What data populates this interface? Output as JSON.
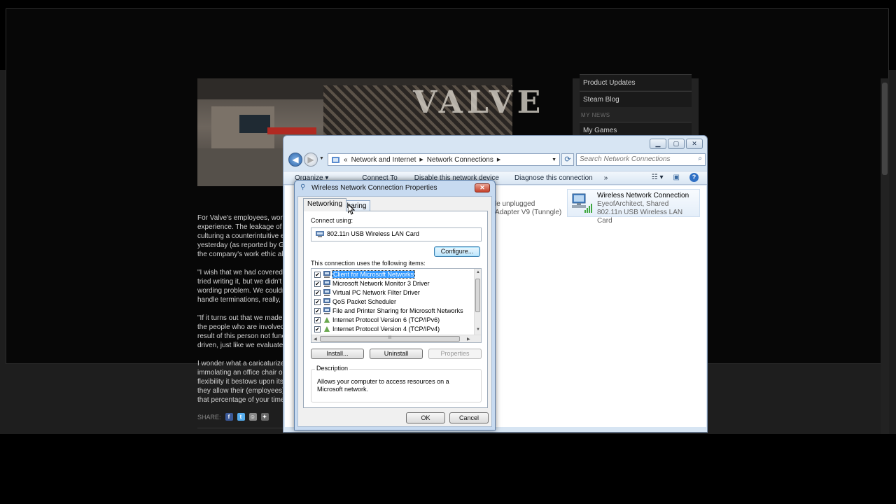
{
  "browser": {
    "logo_text": "VALVE",
    "article": {
      "paragraphs": [
        [
          "For Valve's employees, worki",
          "experience. The leakage of Va",
          "culturing a counterintuitive en",
          "yesterday (as reported by Gee",
          "the company's work ethic also"
        ],
        [
          "\"I wish that we had covered fir",
          "tried writing it, but we didn't fe",
          "wording problem. We couldn't",
          "handle terminations, really, is"
        ],
        [
          "\"If it turns out that we made a",
          "the people who are involved i",
          "result of this person not funct",
          "driven, just like we evaluate e"
        ],
        [
          "I wonder what a caricaturized",
          "immolating an office chair or",
          "flexibility it bestows upon its v",
          "they allow their (employees) t",
          "that percentage of your time is"
        ]
      ],
      "share_label": "SHARE:"
    },
    "sidebar": {
      "product_updates": "Product Updates",
      "steam_blog": "Steam Blog",
      "my_news_header": "MY NEWS",
      "my_games": "My Games"
    }
  },
  "explorer": {
    "breadcrumb": {
      "prefix": "«",
      "items": [
        "Network and Internet",
        "Network Connections"
      ]
    },
    "search_placeholder": "Search Network Connections",
    "commands": [
      "Organize ▾",
      "Connect To",
      "Disable this network device",
      "Diagnose this connection",
      "»"
    ],
    "partial_connection": {
      "line1": "le unplugged",
      "line2": "Adapter V9 (Tunngle)"
    },
    "connection": {
      "name": "Wireless Network Connection",
      "status": "EyeofArchitect, Shared",
      "device": "802.11n USB Wireless LAN Card"
    }
  },
  "dialog": {
    "title": "Wireless Network Connection Properties",
    "tabs": [
      "Networking",
      "Sharing"
    ],
    "connect_using_label": "Connect using:",
    "adapter_name": "802.11n USB Wireless LAN Card",
    "configure_button": "Configure...",
    "items_label": "This connection uses the following items:",
    "items": [
      {
        "label": "Client for Microsoft Networks",
        "checked": true,
        "selected": true
      },
      {
        "label": "Microsoft Network Monitor 3 Driver",
        "checked": true
      },
      {
        "label": "Virtual PC Network Filter Driver",
        "checked": true
      },
      {
        "label": "QoS Packet Scheduler",
        "checked": true
      },
      {
        "label": "File and Printer Sharing for Microsoft Networks",
        "checked": true
      },
      {
        "label": "Internet Protocol Version 6 (TCP/IPv6)",
        "checked": true
      },
      {
        "label": "Internet Protocol Version 4 (TCP/IPv4)",
        "checked": true
      }
    ],
    "hscroll_grip": "III",
    "install_button": "Install...",
    "uninstall_button": "Uninstall",
    "properties_button": "Properties",
    "description_legend": "Description",
    "description_text": "Allows your computer to access resources on a Microsoft network.",
    "ok_button": "OK",
    "cancel_button": "Cancel"
  }
}
